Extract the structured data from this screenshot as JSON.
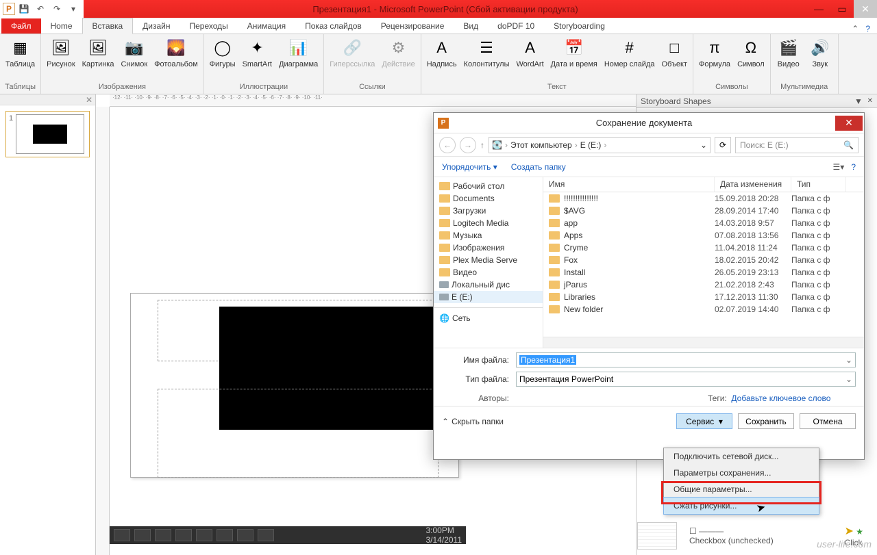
{
  "titlebar": {
    "app_letter": "P",
    "title": "Презентация1 - Microsoft PowerPoint (Сбой активации продукта)"
  },
  "tabs": {
    "file": "Файл",
    "items": [
      "Home",
      "Вставка",
      "Дизайн",
      "Переходы",
      "Анимация",
      "Показ слайдов",
      "Рецензирование",
      "Вид",
      "doPDF 10",
      "Storyboarding"
    ],
    "active_index": 1
  },
  "ribbon": {
    "groups": [
      {
        "label": "Таблицы",
        "items": [
          {
            "icon": "▦",
            "label": "Таблица"
          }
        ]
      },
      {
        "label": "Изображения",
        "items": [
          {
            "icon": "🖼",
            "label": "Рисунок"
          },
          {
            "icon": "🖼",
            "label": "Картинка"
          },
          {
            "icon": "📷",
            "label": "Снимок"
          },
          {
            "icon": "🌄",
            "label": "Фотоальбом"
          }
        ]
      },
      {
        "label": "Иллюстрации",
        "items": [
          {
            "icon": "◯",
            "label": "Фигуры"
          },
          {
            "icon": "✦",
            "label": "SmartArt"
          },
          {
            "icon": "📊",
            "label": "Диаграмма"
          }
        ]
      },
      {
        "label": "Ссылки",
        "items": [
          {
            "icon": "🔗",
            "label": "Гиперссылка",
            "disabled": true
          },
          {
            "icon": "⚙",
            "label": "Действие",
            "disabled": true
          }
        ]
      },
      {
        "label": "Текст",
        "items": [
          {
            "icon": "A",
            "label": "Надпись"
          },
          {
            "icon": "☰",
            "label": "Колонтитулы"
          },
          {
            "icon": "A",
            "label": "WordArt"
          },
          {
            "icon": "📅",
            "label": "Дата и время"
          },
          {
            "icon": "#",
            "label": "Номер слайда"
          },
          {
            "icon": "□",
            "label": "Объект"
          }
        ]
      },
      {
        "label": "Символы",
        "items": [
          {
            "icon": "π",
            "label": "Формула"
          },
          {
            "icon": "Ω",
            "label": "Символ"
          }
        ]
      },
      {
        "label": "Мультимедиа",
        "items": [
          {
            "icon": "🎬",
            "label": "Видео"
          },
          {
            "icon": "🔊",
            "label": "Звук"
          }
        ]
      }
    ]
  },
  "thumb": {
    "number": "1"
  },
  "ruler_h": "·12· ·11· ·10· ·9· ·8· ·7· ·6· ·5· ·4· ·3· ·2· ·1· ·0· ·1· ·2· ·3· ·4· ·5· ·6· ·7· ·8· ·9· ·10· ·11·",
  "rightpane": {
    "title": "Storyboard Shapes"
  },
  "dialog": {
    "title_letter": "P",
    "title": "Сохранение документа",
    "nav": {
      "crumbs": [
        "Этот компьютер",
        "E (E:)"
      ],
      "search_placeholder": "Поиск: E (E:)"
    },
    "toolbar": {
      "organize": "Упорядочить",
      "newfolder": "Создать папку"
    },
    "tree": [
      "Рабочий стол",
      "Documents",
      "Загрузки",
      "Logitech Media",
      "Музыка",
      "Изображения",
      "Plex Media Serve",
      "Видео",
      "Локальный дис",
      "E (E:)"
    ],
    "tree_footer": "Сеть",
    "columns": {
      "name": "Имя",
      "date": "Дата изменения",
      "type": "Тип"
    },
    "rows": [
      {
        "name": "!!!!!!!!!!!!!!!",
        "date": "15.09.2018 20:28",
        "type": "Папка с ф"
      },
      {
        "name": "$AVG",
        "date": "28.09.2014 17:40",
        "type": "Папка с ф"
      },
      {
        "name": "app",
        "date": "14.03.2018 9:57",
        "type": "Папка с ф"
      },
      {
        "name": "Apps",
        "date": "07.08.2018 13:56",
        "type": "Папка с ф"
      },
      {
        "name": "Cryme",
        "date": "11.04.2018 11:24",
        "type": "Папка с ф"
      },
      {
        "name": "Fox",
        "date": "18.02.2015 20:42",
        "type": "Папка с ф"
      },
      {
        "name": "Install",
        "date": "26.05.2019 23:13",
        "type": "Папка с ф"
      },
      {
        "name": "jParus",
        "date": "21.02.2018 2:43",
        "type": "Папка с ф"
      },
      {
        "name": "Libraries",
        "date": "17.12.2013 11:30",
        "type": "Папка с ф"
      },
      {
        "name": "New folder",
        "date": "02.07.2019 14:40",
        "type": "Папка с ф"
      }
    ],
    "filename_label": "Имя файла:",
    "filename_value": "Презентация1",
    "filetype_label": "Тип файла:",
    "filetype_value": "Презентация PowerPoint",
    "authors_label": "Авторы:",
    "tags_label": "Теги:",
    "tags_link": "Добавьте ключевое слово",
    "hide": "Скрыть папки",
    "service": "Сервис",
    "save": "Сохранить",
    "cancel": "Отмена"
  },
  "svcmenu": {
    "items": [
      "Подключить сетевой диск...",
      "Параметры сохранения...",
      "Общие параметры...",
      "Сжать рисунки..."
    ]
  },
  "statusbar": {
    "time": "3:00PM",
    "date": "3/14/2011"
  },
  "shapes_bits": {
    "label1": "Checkbox (unchecked)",
    "label2": "Click"
  },
  "watermark": "user-life.com"
}
